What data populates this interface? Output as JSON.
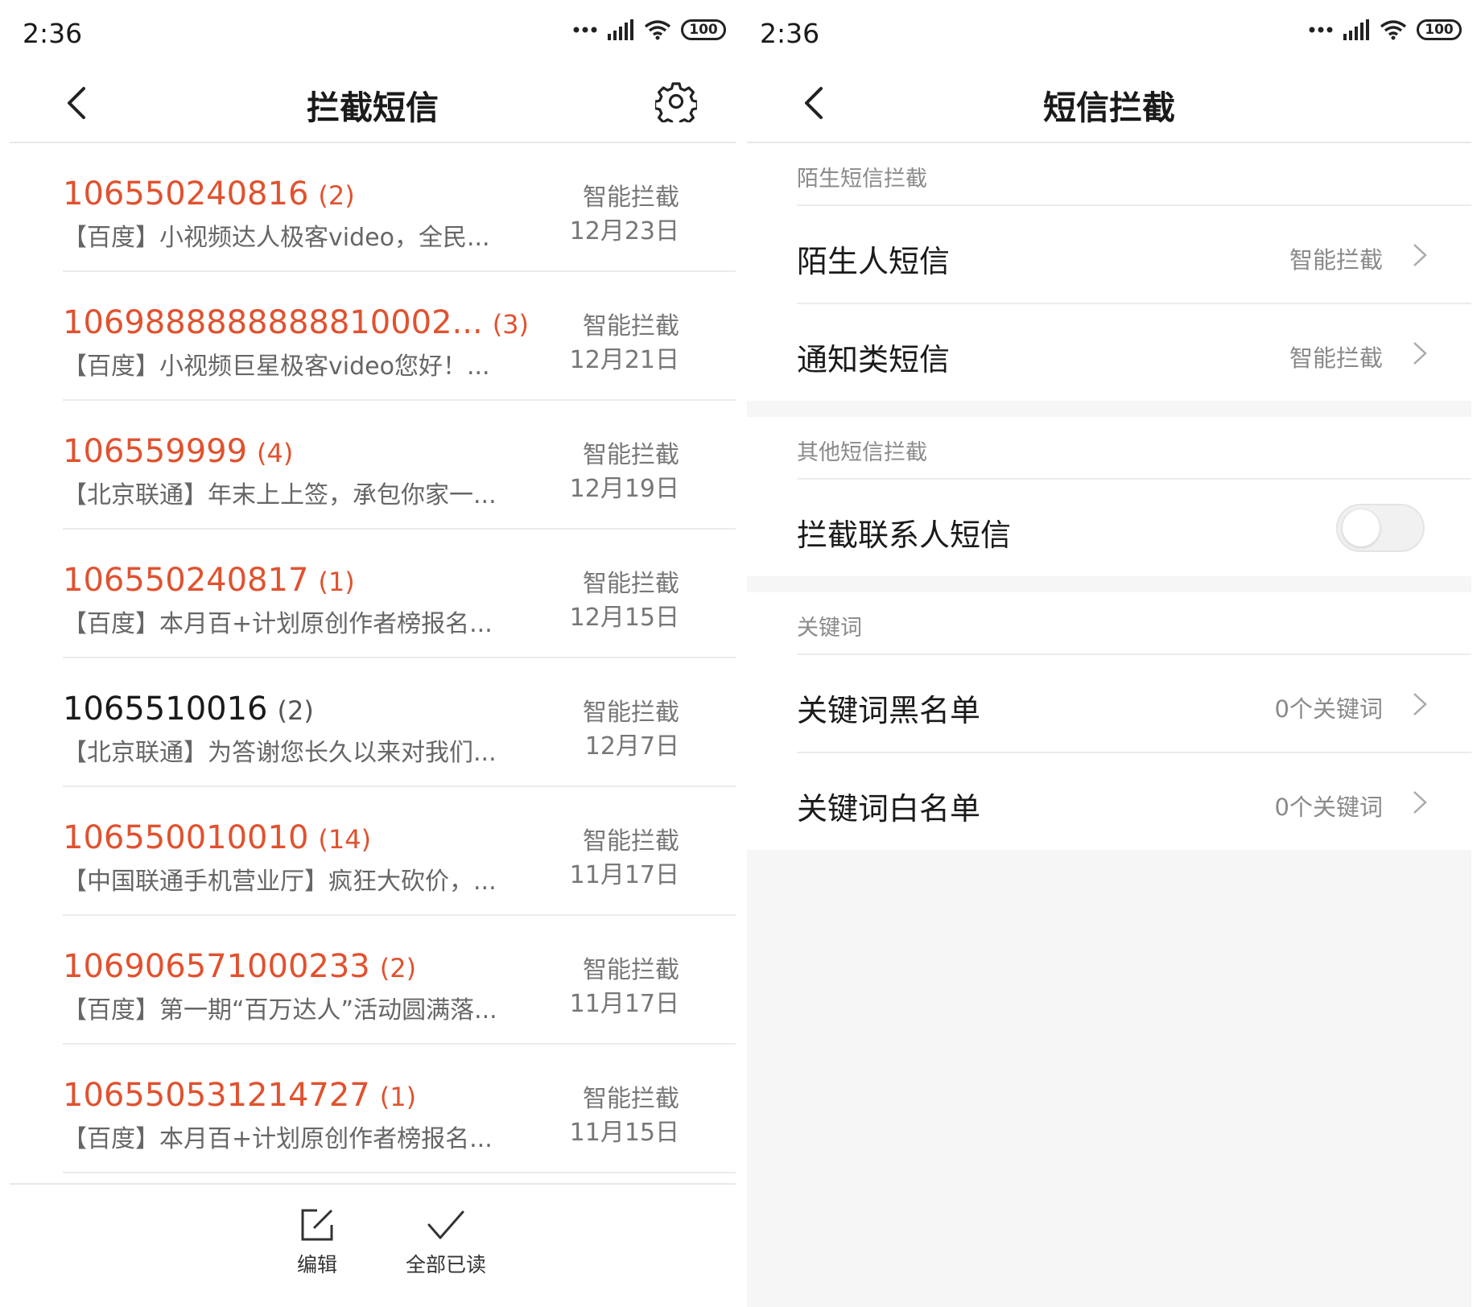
{
  "left": {
    "status": {
      "time": "2:36",
      "battery": "100"
    },
    "title": "拦截短信",
    "messages": [
      {
        "sender": "106550240816",
        "count": "(2)",
        "preview": "【百度】小视频达人极客video，全民...",
        "tag": "智能拦截",
        "date": "12月23日",
        "unread": true
      },
      {
        "sender": "1069888888888810002...",
        "count": "(3)",
        "preview": "【百度】小视频巨星极客video您好！...",
        "tag": "智能拦截",
        "date": "12月21日",
        "unread": true
      },
      {
        "sender": "106559999",
        "count": "(4)",
        "preview": "【北京联通】年末上上签，承包你家一...",
        "tag": "智能拦截",
        "date": "12月19日",
        "unread": true
      },
      {
        "sender": "106550240817",
        "count": "(1)",
        "preview": "【百度】本月百+计划原创作者榜报名...",
        "tag": "智能拦截",
        "date": "12月15日",
        "unread": true
      },
      {
        "sender": "1065510016",
        "count": "(2)",
        "preview": "【北京联通】为答谢您长久以来对我们...",
        "tag": "智能拦截",
        "date": "12月7日",
        "unread": false
      },
      {
        "sender": "106550010010",
        "count": "(14)",
        "preview": "【中国联通手机营业厅】疯狂大砍价，...",
        "tag": "智能拦截",
        "date": "11月17日",
        "unread": true
      },
      {
        "sender": "106906571000233",
        "count": "(2)",
        "preview": "【百度】第一期“百万达人”活动圆满落...",
        "tag": "智能拦截",
        "date": "11月17日",
        "unread": true
      },
      {
        "sender": "106550531214727",
        "count": "(1)",
        "preview": "【百度】本月百+计划原创作者榜报名...",
        "tag": "智能拦截",
        "date": "11月15日",
        "unread": true
      }
    ],
    "actions": {
      "edit": "编辑",
      "mark_all_read": "全部已读"
    }
  },
  "right": {
    "status": {
      "time": "2:36",
      "battery": "100"
    },
    "title": "短信拦截",
    "stranger": {
      "header": "陌生短信拦截",
      "stranger_sms": {
        "label": "陌生人短信",
        "value": "智能拦截"
      },
      "notice_sms": {
        "label": "通知类短信",
        "value": "智能拦截"
      }
    },
    "other": {
      "header": "其他短信拦截",
      "block_contacts": {
        "label": "拦截联系人短信",
        "enabled": false
      }
    },
    "keywords": {
      "header": "关键词",
      "blacklist": {
        "label": "关键词黑名单",
        "value": "0个关键词"
      },
      "whitelist": {
        "label": "关键词白名单",
        "value": "0个关键词"
      }
    }
  },
  "colors": {
    "accent": "#e0522f",
    "text": "#1a1a1a",
    "secondary": "#8a8a8a"
  }
}
